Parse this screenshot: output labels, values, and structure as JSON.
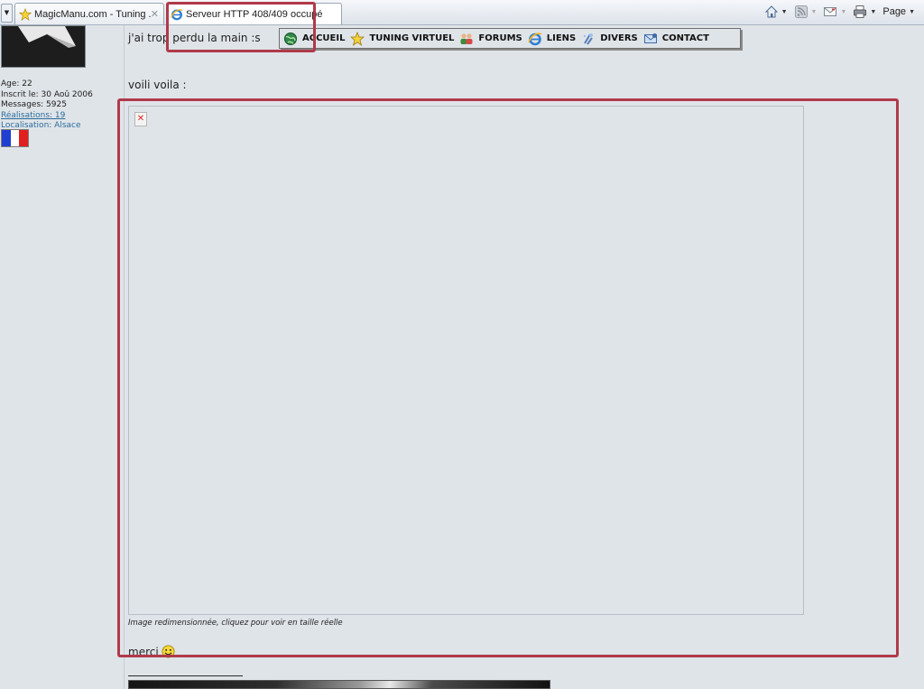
{
  "browser": {
    "tabs": [
      {
        "label": "MagicManu.com - Tuning ...",
        "active": false
      },
      {
        "label": "Serveur HTTP 408/409 occupé",
        "active": true
      }
    ],
    "toolbar": {
      "page_label": "Page"
    }
  },
  "author": {
    "profile_lines": {
      "age": "Age: 22",
      "joined": "Inscrit le: 30 Aoû 2006",
      "messages": "Messages: 5925",
      "realisations": "Réalisations: 19",
      "location": "Localisation: Alsace"
    },
    "flag_colors": [
      "#1e3fd0",
      "#ffffff",
      "#e0201e"
    ]
  },
  "post": {
    "line1": "j'ai trop perdu la main :s",
    "line2": "voili voila :",
    "image_caption": "Image redimensionnée, cliquez pour voir en taille réelle",
    "closing": "merci"
  },
  "site_nav": [
    {
      "label": "ACCUEIL",
      "icon": "globe-icon"
    },
    {
      "label": "TUNING VIRTUEL",
      "icon": "star-icon"
    },
    {
      "label": "FORUMS",
      "icon": "users-icon"
    },
    {
      "label": "LIENS",
      "icon": "ie-icon"
    },
    {
      "label": "DIVERS",
      "icon": "sparkle-icon"
    },
    {
      "label": "CONTACT",
      "icon": "envelope-icon"
    }
  ],
  "colors": {
    "page_bg": "#dfe4e8",
    "highlight": "#b13a4a",
    "link": "#2b6c9d"
  }
}
